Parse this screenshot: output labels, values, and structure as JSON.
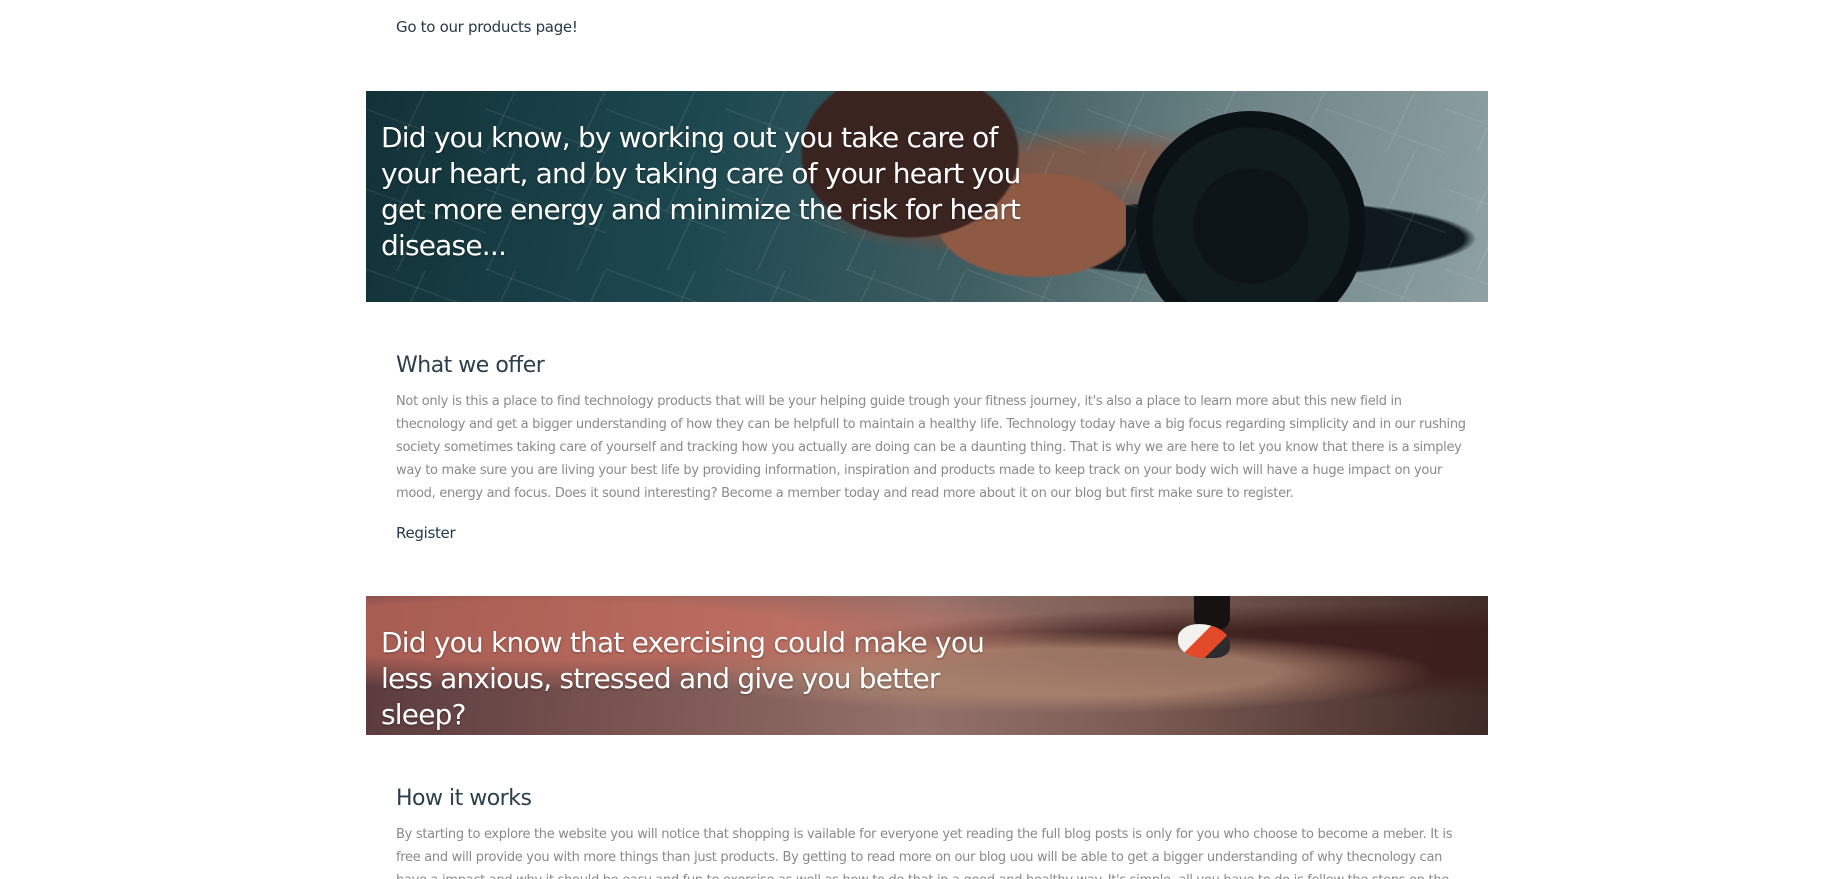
{
  "nav": {
    "products_link": "Go to our products page!"
  },
  "banners": [
    {
      "text": "Did you know, by working out you take care of your heart, and by taking care of your heart you get more energy and minimize the risk for heart disease..."
    },
    {
      "text": "Did you know that exercising could make you less anxious, stressed and give you better sleep?"
    }
  ],
  "offer": {
    "title": "What we offer",
    "body": "Not only is this a place to find technology products that will be your helping guide trough your fitness journey, it's also a place to learn more abut this new field in thecnology and get a bigger understanding of how they can be helpfull to maintain a healthy life. Technology today have a big focus regarding simplicity and in our rushing society sometimes taking care of yourself and tracking how you actually are doing can be a daunting thing. That is why we are here to let you know that there is a simpley way to make sure you are living your best life by providing information, inspiration and products made to keep track on your body wich will have a huge impact on your mood, energy and focus. Does it sound interesting? Become a member today and read more about it on our blog but first make sure to register.",
    "register_link": "Register"
  },
  "how": {
    "title": "How it works",
    "body": "By starting to explore the website you will notice that shopping is vailable for everyone yet reading the full blog posts is only for you who choose to become a meber. It is free and will provide you with more things than just products. By getting to read more on our blog uou will be able to get a bigger understanding of why thecnology can have a impact and why it should be easy and fun to exercise as well as how to do that in a good and healthy way. It's simple, all you have to do is follow the steps on the register form and create an account. Once"
  }
}
